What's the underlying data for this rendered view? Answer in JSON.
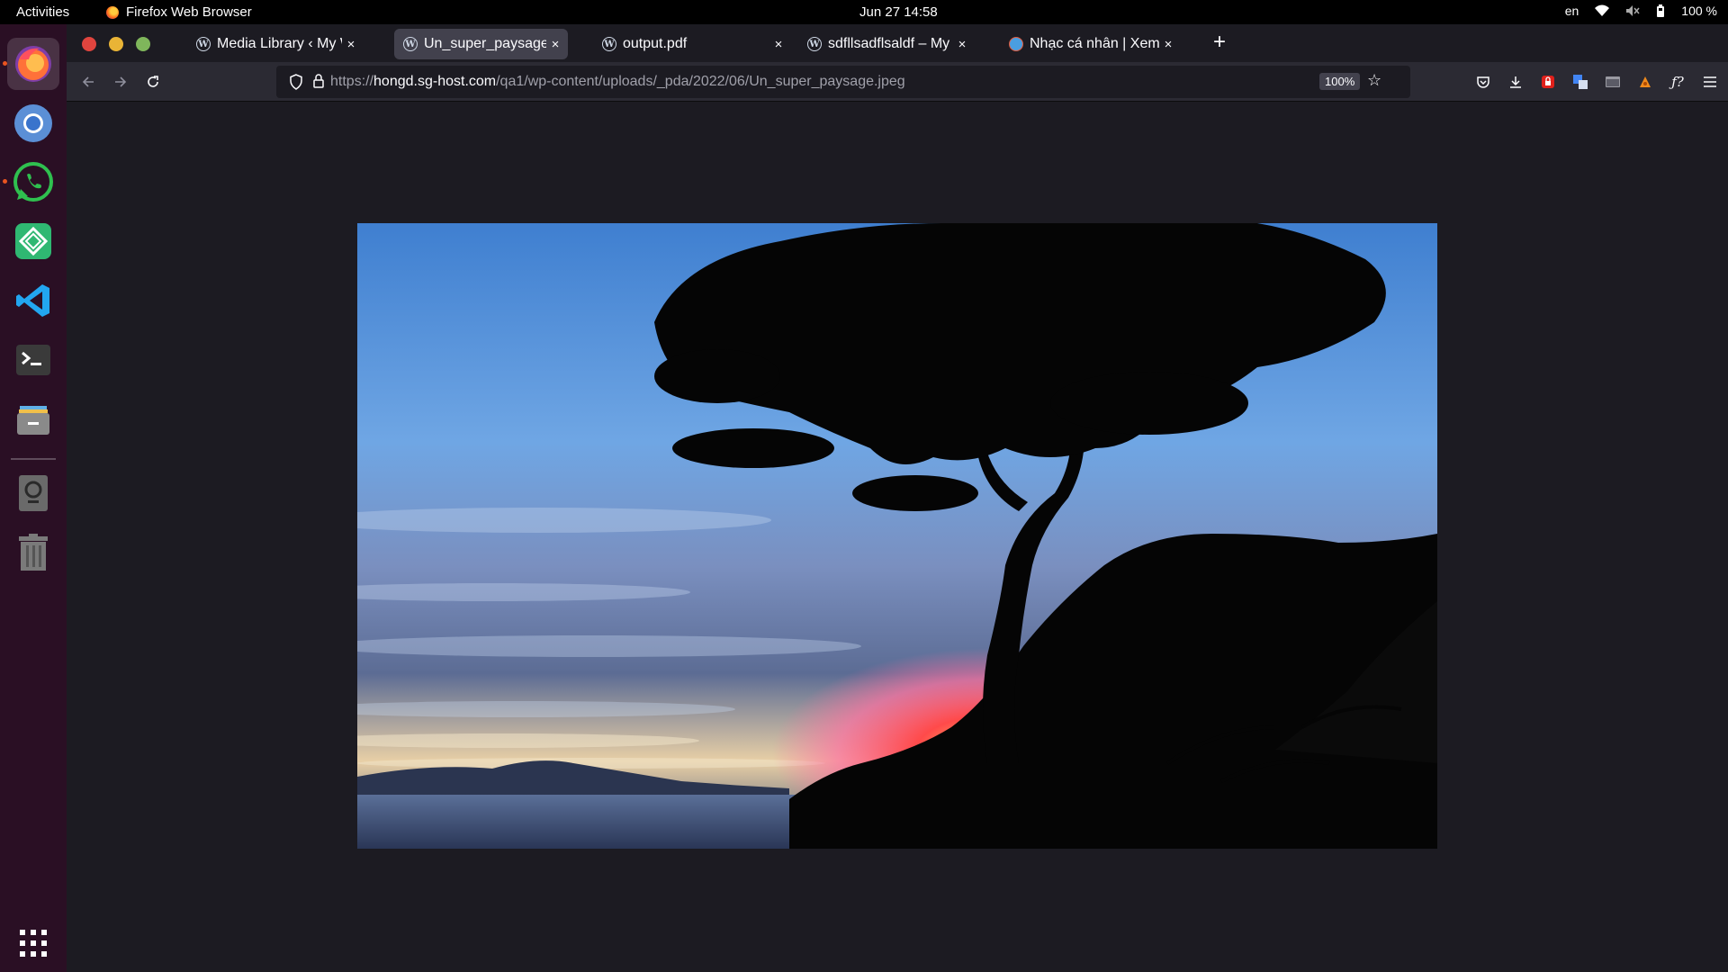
{
  "topbar": {
    "activities": "Activities",
    "app_name": "Firefox Web Browser",
    "clock": "Jun 27  14:58",
    "lang": "en",
    "battery": "100 %"
  },
  "dock": {
    "items": [
      "firefox",
      "chromium",
      "whatsapp",
      "gitkraken",
      "vscode",
      "terminal",
      "files",
      "screenshot",
      "trash",
      "show-apps"
    ]
  },
  "tabs": [
    {
      "label": "Media Library ‹ My Wor",
      "active": false
    },
    {
      "label": "Un_super_paysage.jpeg",
      "active": true
    },
    {
      "label": "output.pdf",
      "active": false
    },
    {
      "label": "sdfllsadflsaldf – My Wo",
      "active": false
    },
    {
      "label": "Nhạc cá nhân | Xem bài",
      "active": false
    }
  ],
  "urlbar": {
    "scheme": "https://",
    "host_pre": "hongd.",
    "host": "sg-host.com",
    "path": "/qa1/wp-content/uploads/_pda/2022/06/Un_super_paysage.jpeg",
    "zoom": "100%"
  },
  "image": {
    "description_icon": "sunset-tree-landscape-photo"
  },
  "colors": {
    "accent": "#e95420",
    "browser_bg": "#1c1b22",
    "toolbar_bg": "#2b2a33"
  }
}
